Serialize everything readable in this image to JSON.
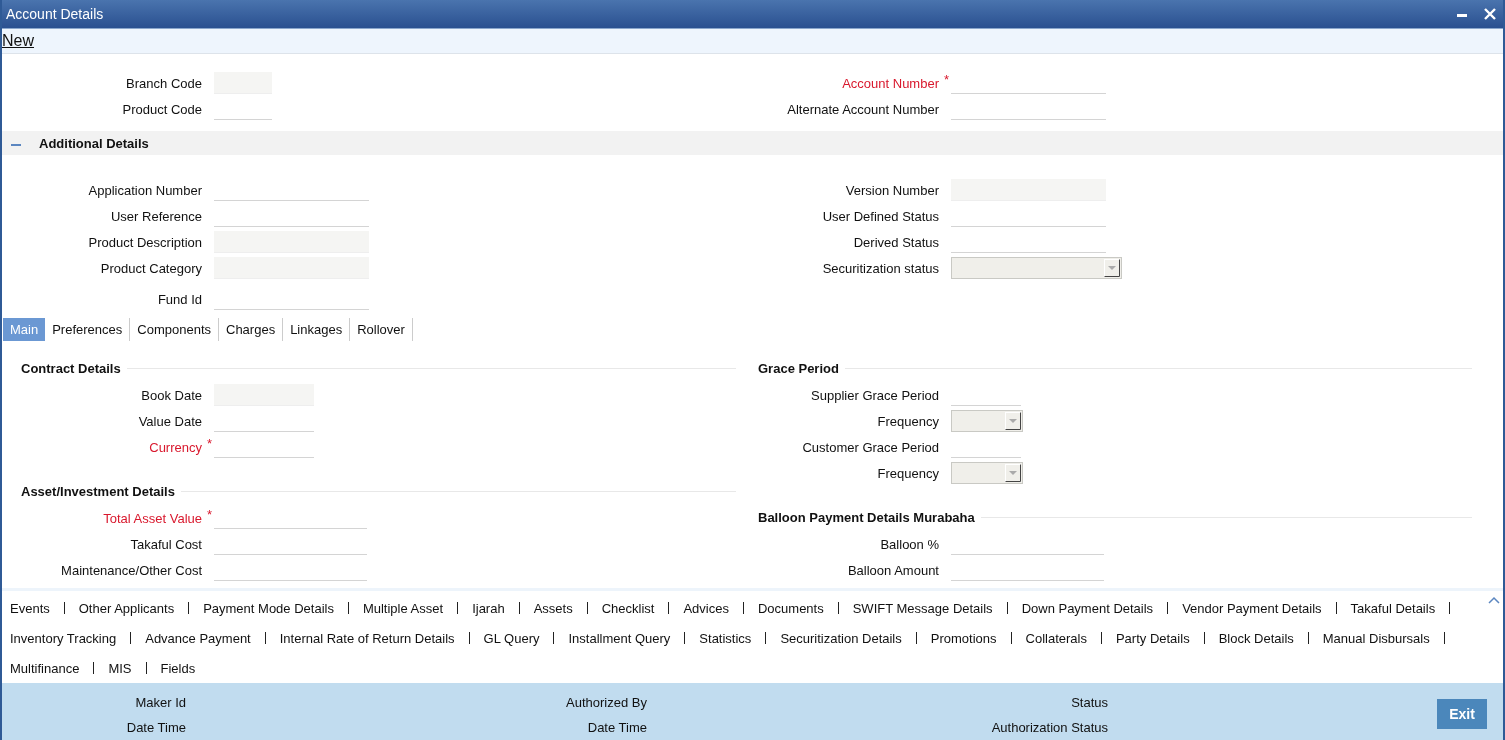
{
  "window": {
    "title": "Account Details"
  },
  "toolbar": {
    "links": [
      {
        "label": "New"
      }
    ]
  },
  "header": {
    "left": [
      {
        "label": "Branch Code",
        "kind": "readonly",
        "required": false
      },
      {
        "label": "Product Code",
        "kind": "text",
        "required": false
      }
    ],
    "right": [
      {
        "label": "Account Number",
        "kind": "text",
        "required": true,
        "mark": "*"
      },
      {
        "label": "Alternate Account Number",
        "kind": "text",
        "required": false
      }
    ]
  },
  "additional_details": {
    "title": "Additional Details",
    "expanded": true,
    "left": [
      {
        "label": "Application Number",
        "kind": "text",
        "required": false
      },
      {
        "label": "User Reference",
        "kind": "text",
        "required": false
      },
      {
        "label": "Product Description",
        "kind": "readonly",
        "required": false
      },
      {
        "label": "Product Category",
        "kind": "readonly",
        "required": false
      },
      {
        "label": "Fund Id",
        "kind": "text",
        "required": false
      }
    ],
    "right": [
      {
        "label": "Version Number",
        "kind": "readonly",
        "required": false
      },
      {
        "label": "User Defined Status",
        "kind": "text",
        "required": false
      },
      {
        "label": "Derived Status",
        "kind": "text",
        "required": false
      },
      {
        "label": "Securitization status",
        "kind": "select",
        "required": false
      }
    ]
  },
  "tabs": [
    {
      "label": "Main",
      "selected": true
    },
    {
      "label": "Preferences",
      "selected": false
    },
    {
      "label": "Components",
      "selected": false
    },
    {
      "label": "Charges",
      "selected": false
    },
    {
      "label": "Linkages",
      "selected": false
    },
    {
      "label": "Rollover",
      "selected": false
    }
  ],
  "main_tab": {
    "left_sections": [
      {
        "title": "Contract Details",
        "fields": [
          {
            "label": "Book Date",
            "kind": "readonly",
            "required": false
          },
          {
            "label": "Value Date",
            "kind": "text",
            "required": false
          },
          {
            "label": "Currency",
            "kind": "text",
            "required": true,
            "mark": "*"
          }
        ]
      },
      {
        "title": "Asset/Investment Details",
        "fields": [
          {
            "label": "Total Asset Value",
            "kind": "text",
            "required": true,
            "mark": "*"
          },
          {
            "label": "Takaful Cost",
            "kind": "text",
            "required": false
          },
          {
            "label": "Maintenance/Other Cost",
            "kind": "text",
            "required": false
          }
        ]
      }
    ],
    "right_sections": [
      {
        "title": "Grace Period",
        "fields": [
          {
            "label": "Supplier Grace Period",
            "kind": "text",
            "required": false
          },
          {
            "label": "Frequency",
            "kind": "select",
            "required": false
          },
          {
            "label": "Customer Grace Period",
            "kind": "text",
            "required": false
          },
          {
            "label": "Frequency",
            "kind": "select",
            "required": false
          }
        ]
      },
      {
        "title": "Balloon Payment Details Murabaha",
        "fields": [
          {
            "label": "Balloon %",
            "kind": "text",
            "required": false
          },
          {
            "label": "Balloon Amount",
            "kind": "text",
            "required": false
          }
        ]
      }
    ]
  },
  "subscreen_links": [
    "Events",
    "Other Applicants",
    "Payment Mode Details",
    "Multiple Asset",
    "Ijarah",
    "Assets",
    "Checklist",
    "Advices",
    "Documents",
    "SWIFT Message Details",
    "Down Payment Details",
    "Vendor Payment Details",
    "Takaful Details",
    "Inventory Tracking",
    "Advance Payment",
    "Internal Rate of Return Details",
    "GL Query",
    "Installment Query",
    "Statistics",
    "Securitization Details",
    "Promotions",
    "Collaterals",
    "Party Details",
    "Block Details",
    "Manual Disbursals",
    "Multifinance",
    "MIS",
    "Fields"
  ],
  "audit": {
    "groups": [
      {
        "labels": [
          "Maker Id",
          "Date Time"
        ]
      },
      {
        "labels": [
          "Authorized By",
          "Date Time"
        ]
      },
      {
        "labels": [
          "Status",
          "Authorization Status"
        ]
      }
    ]
  },
  "buttons": [
    {
      "label": "Exit"
    }
  ]
}
